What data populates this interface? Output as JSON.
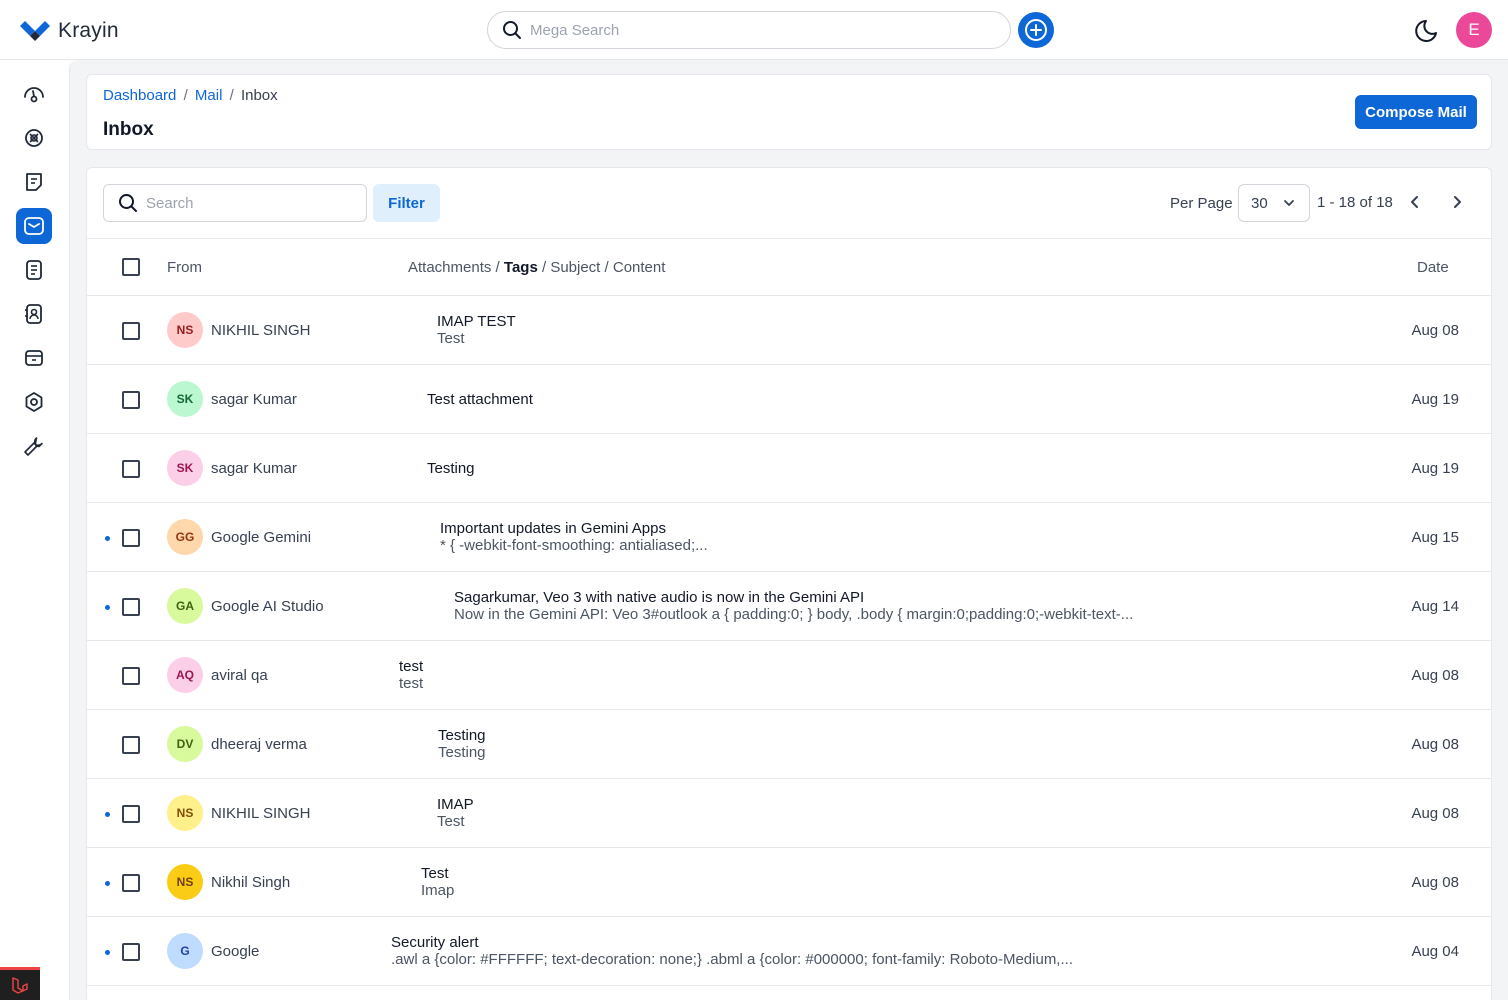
{
  "app": {
    "name": "Krayin"
  },
  "topbar": {
    "search_placeholder": "Mega Search",
    "user_initial": "E"
  },
  "sidebar": {
    "items": [
      {
        "icon": "dashboard-gauge-icon"
      },
      {
        "icon": "leads-icon"
      },
      {
        "icon": "quotes-icon"
      },
      {
        "icon": "mail-icon",
        "active": true
      },
      {
        "icon": "activities-icon"
      },
      {
        "icon": "contacts-icon"
      },
      {
        "icon": "products-icon"
      },
      {
        "icon": "settings-icon"
      },
      {
        "icon": "configuration-wrench-icon"
      }
    ]
  },
  "breadcrumb": {
    "dashboard": "Dashboard",
    "mail": "Mail",
    "current": "Inbox",
    "separator": "/"
  },
  "page": {
    "title": "Inbox",
    "compose_label": "Compose Mail"
  },
  "toolbar": {
    "search_placeholder": "Search",
    "filter_label": "Filter",
    "per_page_label": "Per Page",
    "per_page_value": "30",
    "page_info": "1 - 18 of 18"
  },
  "columns": {
    "from": "From",
    "attachments": "Attachments",
    "tags": "Tags",
    "subject": "Subject",
    "content": "Content",
    "separator": "/",
    "date": "Date"
  },
  "rows": [
    {
      "initials": "NS",
      "name": "NIKHIL SINGH",
      "subject": "IMAP TEST",
      "preview": "Test",
      "date": "Aug 08",
      "unread": false,
      "avatar_bg": "#fecaca",
      "avatar_fg": "#991b1b"
    },
    {
      "initials": "SK",
      "name": "sagar Kumar",
      "subject": "Test attachment",
      "preview": "",
      "date": "Aug 19",
      "unread": false,
      "avatar_bg": "#bbf7d0",
      "avatar_fg": "#166534"
    },
    {
      "initials": "SK",
      "name": "sagar Kumar",
      "subject": "Testing",
      "preview": "",
      "date": "Aug 19",
      "unread": false,
      "avatar_bg": "#fbcfe8",
      "avatar_fg": "#9d174d"
    },
    {
      "initials": "GG",
      "name": "Google Gemini",
      "subject": "Important updates in Gemini Apps",
      "preview": "* { -webkit-font-smoothing: antialiased;...",
      "date": "Aug 15",
      "unread": true,
      "avatar_bg": "#fed7aa",
      "avatar_fg": "#9a3412"
    },
    {
      "initials": "GA",
      "name": "Google AI Studio",
      "subject": "Sagarkumar, Veo 3 with native audio is now in the Gemini API",
      "preview": "Now in the Gemini API: Veo 3#outlook a { padding:0; } body, .body { margin:0;padding:0;-webkit-text-...",
      "date": "Aug 14",
      "unread": true,
      "avatar_bg": "#d9f99d",
      "avatar_fg": "#3f6212"
    },
    {
      "initials": "AQ",
      "name": "aviral qa",
      "subject": "test",
      "preview": "test",
      "date": "Aug 08",
      "unread": false,
      "avatar_bg": "#fbcfe8",
      "avatar_fg": "#9d174d"
    },
    {
      "initials": "DV",
      "name": "dheeraj verma",
      "subject": "Testing",
      "preview": "Testing",
      "date": "Aug 08",
      "unread": false,
      "avatar_bg": "#d9f99d",
      "avatar_fg": "#3f6212"
    },
    {
      "initials": "NS",
      "name": "NIKHIL SINGH",
      "subject": "IMAP",
      "preview": "Test",
      "date": "Aug 08",
      "unread": true,
      "avatar_bg": "#fef08a",
      "avatar_fg": "#854d0e"
    },
    {
      "initials": "NS",
      "name": "Nikhil Singh",
      "subject": "Test",
      "preview": "Imap",
      "date": "Aug 08",
      "unread": true,
      "avatar_bg": "#facc15",
      "avatar_fg": "#713f12"
    },
    {
      "initials": "G",
      "name": "Google",
      "subject": "Security alert",
      "preview": ".awl a {color: #FFFFFF; text-decoration: none;} .abml a {color: #000000; font-family: Roboto-Medium,...",
      "date": "Aug 04",
      "unread": true,
      "avatar_bg": "#bfdbfe",
      "avatar_fg": "#1e40af"
    }
  ],
  "colors": {
    "primary": "#0e67d6",
    "filter_bg": "#e0effc",
    "user_avatar": "#ec4899"
  }
}
